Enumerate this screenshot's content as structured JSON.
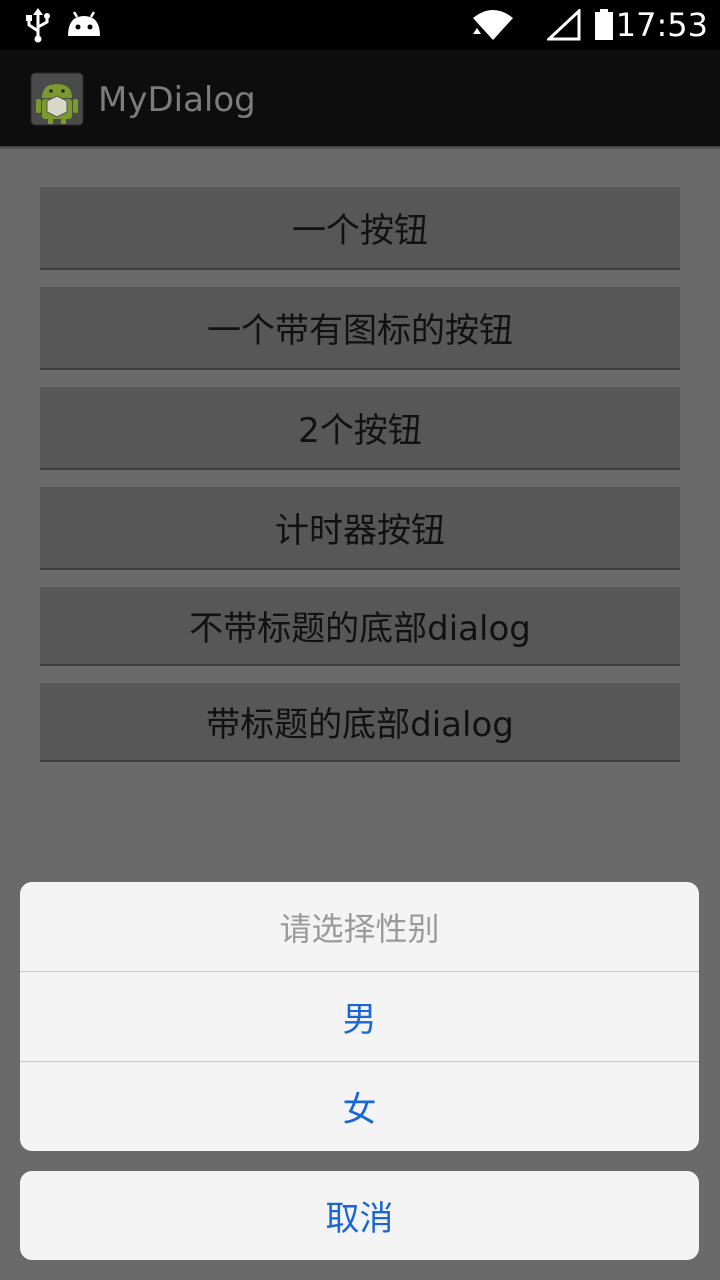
{
  "status_bar": {
    "time": "17:53",
    "icons": [
      "usb-icon",
      "android-debug-icon",
      "wifi-icon",
      "signal-icon",
      "battery-icon"
    ]
  },
  "action_bar": {
    "title": "MyDialog",
    "icon": "android-app-icon"
  },
  "buttons": [
    {
      "label": "一个按钮"
    },
    {
      "label": "一个带有图标的按钮"
    },
    {
      "label": "2个按钮"
    },
    {
      "label": "计时器按钮"
    },
    {
      "label": "不带标题的底部dialog"
    },
    {
      "label": "带标题的底部dialog"
    }
  ],
  "action_sheet": {
    "title": "请选择性别",
    "options": [
      {
        "label": "男"
      },
      {
        "label": "女"
      }
    ],
    "cancel_label": "取消"
  },
  "colors": {
    "overlay": "#6a6a6a",
    "option_text": "#1a66d6",
    "sheet_bg": "#f4f4f4"
  }
}
